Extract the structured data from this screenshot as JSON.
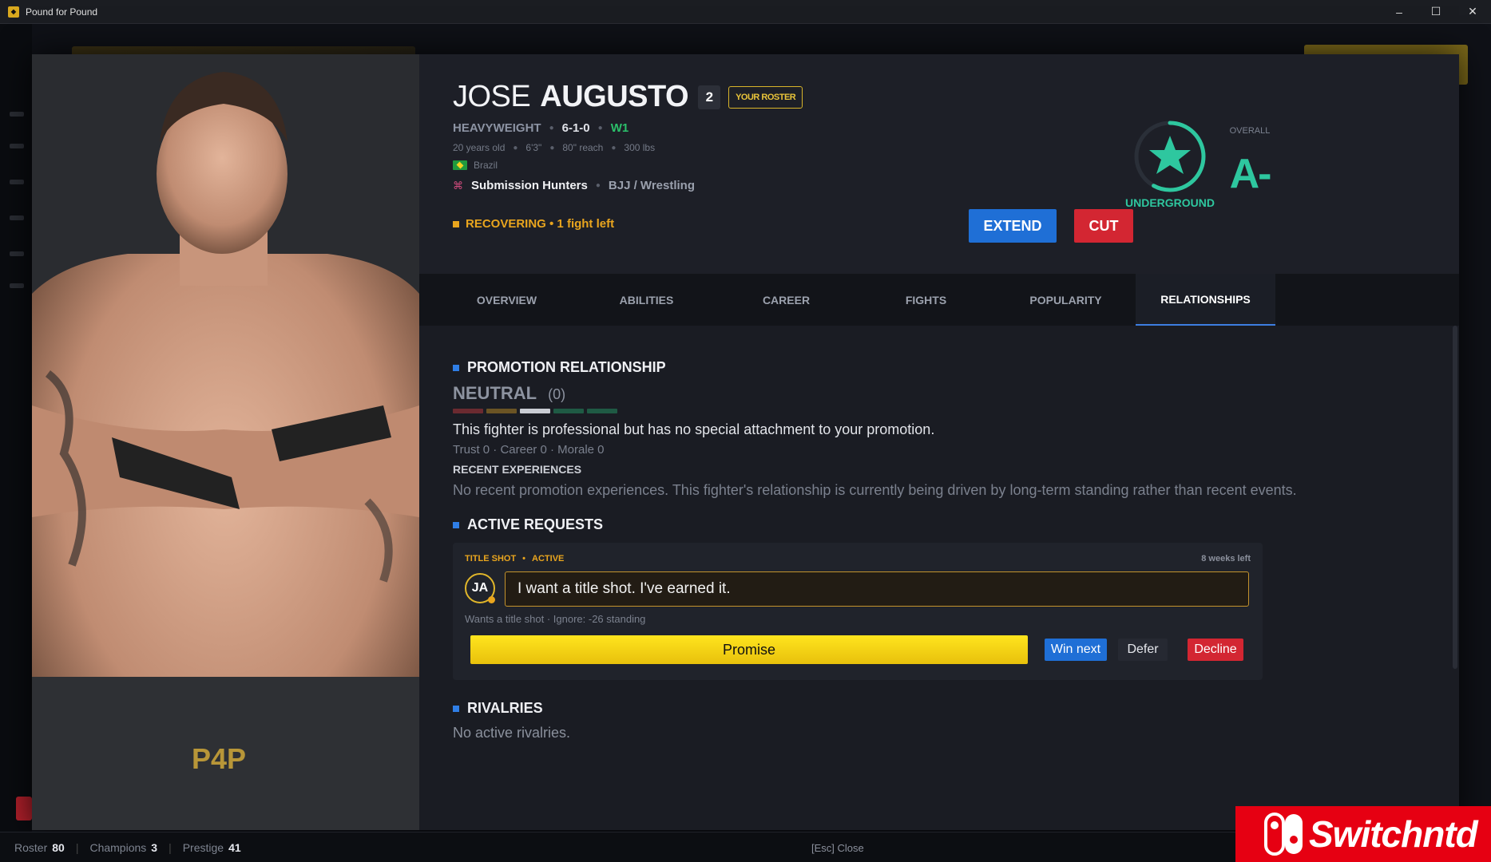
{
  "window": {
    "title": "Pound for Pound",
    "minimize": "–",
    "maximize": "☐",
    "close": "✕"
  },
  "fighter": {
    "first_name": "JOSE",
    "last_name": "AUGUSTO",
    "rank": "2",
    "roster_badge": "YOUR ROSTER",
    "weight_class": "HEAVYWEIGHT",
    "record": "6-1-0",
    "streak": "W1",
    "age": "20 years old",
    "height": "6'3\"",
    "reach": "80\" reach",
    "weight": "300 lbs",
    "country": "Brazil",
    "style": "Submission Hunters",
    "disciplines": "BJJ / Wrestling",
    "status": "RECOVERING • 1 fight left",
    "tier": "UNDERGROUND",
    "overall_label": "OVERALL",
    "overall_grade": "A-",
    "tier_progress": 0.58
  },
  "actions": {
    "extend": "EXTEND",
    "cut": "CUT",
    "close": "✕"
  },
  "tabs": [
    {
      "label": "OVERVIEW"
    },
    {
      "label": "ABILITIES"
    },
    {
      "label": "CAREER"
    },
    {
      "label": "FIGHTS"
    },
    {
      "label": "POPULARITY"
    },
    {
      "label": "RELATIONSHIPS",
      "active": true
    }
  ],
  "relationship": {
    "section_title": "PROMOTION RELATIONSHIP",
    "level": "NEUTRAL",
    "score": "(0)",
    "description": "This fighter is professional but has no special attachment to your promotion.",
    "stats": "Trust 0 · Career 0 · Morale 0",
    "recent_title": "RECENT EXPERIENCES",
    "recent_text": "No recent promotion experiences. This fighter's relationship is currently being driven by long-term standing rather than recent events.",
    "scale_colors": [
      "#6b2a30",
      "#6b5424",
      "#c9ccd3",
      "#1f5a44",
      "#1f5a44"
    ]
  },
  "requests": {
    "section_title": "ACTIVE REQUESTS",
    "items": [
      {
        "type": "TITLE SHOT",
        "state": "ACTIVE",
        "time_left": "8 weeks left",
        "initials": "JA",
        "quote": "I want a title shot. I've earned it.",
        "meta": "Wants a title shot · Ignore: -26 standing",
        "promise": "Promise",
        "win_next": "Win next",
        "defer": "Defer",
        "decline": "Decline"
      }
    ]
  },
  "rivalries": {
    "section_title": "RIVALRIES",
    "text": "No active rivalries."
  },
  "footer": {
    "roster_label": "Roster",
    "roster_value": "80",
    "champions_label": "Champions",
    "champions_value": "3",
    "prestige_label": "Prestige",
    "prestige_value": "41",
    "esc_hint": "[Esc] Close"
  },
  "watermark": {
    "text": "Switchntd"
  },
  "colors": {
    "accent_blue": "#1f6fd6",
    "danger_red": "#d32632",
    "gold": "#e9c43a",
    "tier_green": "#2ec79f"
  }
}
